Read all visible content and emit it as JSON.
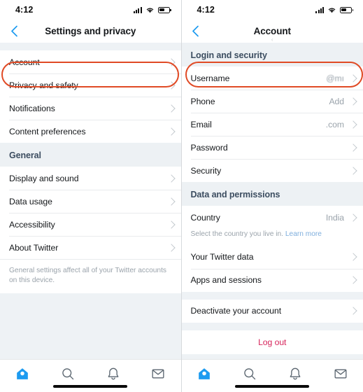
{
  "colors": {
    "accent_blue": "#1d9bf0",
    "highlight_red": "#e04a25",
    "logout_red": "#d6245b",
    "section_header_text": "#3c4d60",
    "muted_text": "#9aa3ab",
    "link_blue": "#7eaedd"
  },
  "status_bar": {
    "time": "4:12",
    "signal_icon": "cellular-signal-icon",
    "wifi_icon": "wifi-icon",
    "battery_icon": "battery-icon"
  },
  "left_screen": {
    "nav": {
      "back_icon": "back-chevron-icon",
      "title": "Settings and privacy"
    },
    "sections": [
      {
        "header": null,
        "rows": [
          {
            "label": "Account",
            "value": "",
            "highlighted": true
          },
          {
            "label": "Privacy and safety",
            "value": ""
          },
          {
            "label": "Notifications",
            "value": ""
          },
          {
            "label": "Content preferences",
            "value": ""
          }
        ]
      },
      {
        "header": "General",
        "rows": [
          {
            "label": "Display and sound",
            "value": ""
          },
          {
            "label": "Data usage",
            "value": ""
          },
          {
            "label": "Accessibility",
            "value": ""
          },
          {
            "label": "About Twitter",
            "value": ""
          }
        ],
        "footnote": "General settings affect all of your Twitter accounts on this device."
      }
    ]
  },
  "right_screen": {
    "nav": {
      "back_icon": "back-chevron-icon",
      "title": "Account",
      "ghost_chevron": "‹"
    },
    "sections": [
      {
        "header": "Login and security",
        "rows": [
          {
            "label": "Username",
            "value": "@mı",
            "highlighted": true,
            "blurred": true
          },
          {
            "label": "Phone",
            "value": "Add"
          },
          {
            "label": "Email",
            "value": ".com"
          },
          {
            "label": "Password",
            "value": ""
          },
          {
            "label": "Security",
            "value": ""
          }
        ]
      },
      {
        "header": "Data and permissions",
        "rows": [
          {
            "label": "Country",
            "value": "India",
            "note": "Select the country you live in.",
            "note_link": "Learn more"
          },
          {
            "label": "Your Twitter data",
            "value": ""
          },
          {
            "label": "Apps and sessions",
            "value": ""
          }
        ]
      },
      {
        "header": null,
        "rows": [
          {
            "label": "Deactivate your account",
            "value": ""
          }
        ]
      }
    ],
    "logout_label": "Log out"
  },
  "tab_bar": {
    "tabs": [
      {
        "icon": "home-icon",
        "active": true
      },
      {
        "icon": "search-icon",
        "active": false
      },
      {
        "icon": "bell-icon",
        "active": false
      },
      {
        "icon": "mail-icon",
        "active": false
      }
    ]
  }
}
